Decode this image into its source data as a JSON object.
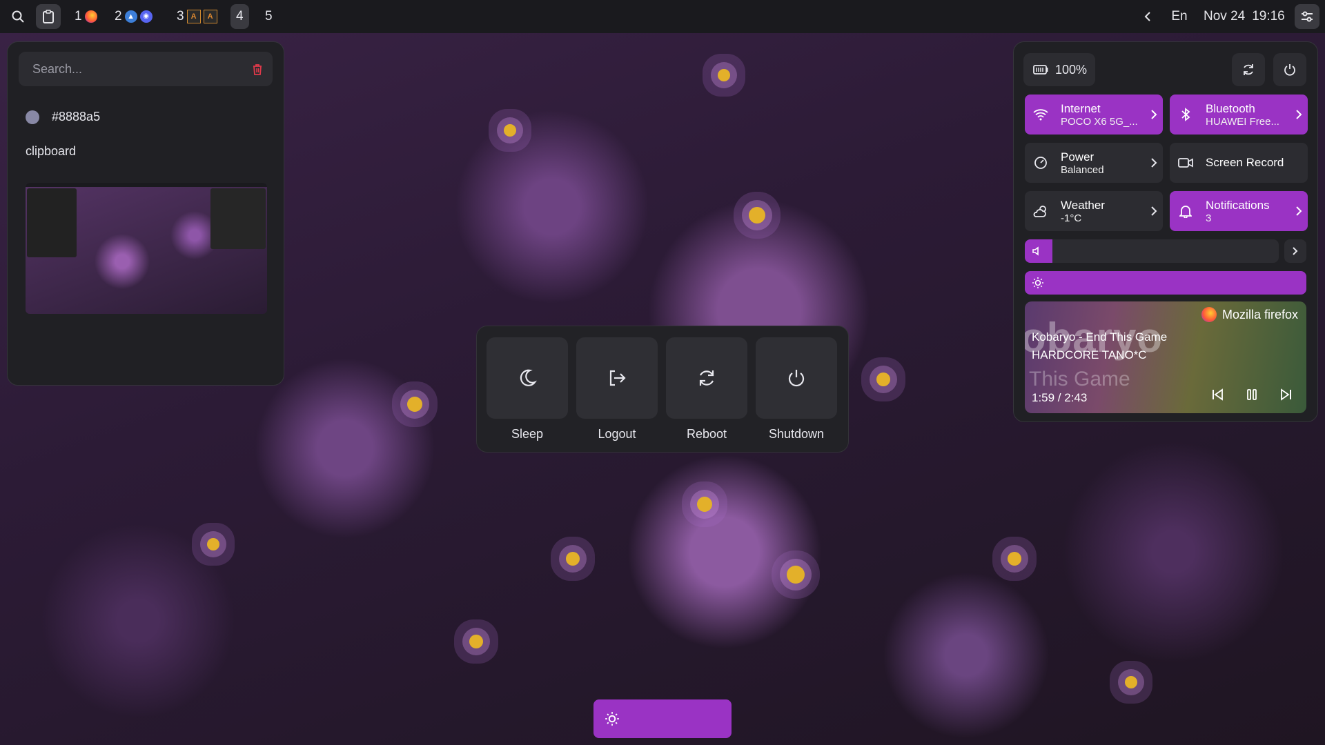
{
  "topbar": {
    "workspaces": [
      {
        "num": "1",
        "apps": [
          "firefox-icon"
        ]
      },
      {
        "num": "2",
        "apps": [
          "arch-icon",
          "discord-icon"
        ]
      },
      {
        "num": "3",
        "apps": [
          "app-a-icon",
          "app-a-icon"
        ]
      },
      {
        "num": "4",
        "apps": []
      },
      {
        "num": "5",
        "apps": []
      }
    ],
    "active_workspace": "4",
    "language": "En",
    "date": "Nov 24",
    "time": "19:16"
  },
  "clipboard": {
    "search_placeholder": "Search...",
    "items": [
      {
        "type": "color",
        "value": "#8888a5"
      },
      {
        "type": "text",
        "value": "clipboard"
      },
      {
        "type": "image",
        "value": "screenshot-thumbnail"
      }
    ]
  },
  "power_menu": {
    "items": [
      {
        "label": "Sleep",
        "icon": "moon-icon"
      },
      {
        "label": "Logout",
        "icon": "logout-icon"
      },
      {
        "label": "Reboot",
        "icon": "reboot-icon"
      },
      {
        "label": "Shutdown",
        "icon": "power-icon"
      }
    ]
  },
  "quick_settings": {
    "battery": "100%",
    "tiles": [
      {
        "title": "Internet",
        "subtitle": "POCO X6 5G_...",
        "icon": "wifi-icon",
        "active": true
      },
      {
        "title": "Bluetooth",
        "subtitle": "HUAWEI Free...",
        "icon": "bluetooth-icon",
        "active": true
      },
      {
        "title": "Power",
        "subtitle": "Balanced",
        "icon": "power-profile-icon",
        "active": false
      },
      {
        "title": "Screen Record",
        "subtitle": "",
        "icon": "camera-icon",
        "active": false
      },
      {
        "title": "Weather",
        "subtitle": "-1°C",
        "icon": "weather-icon",
        "active": false
      },
      {
        "title": "Notifications",
        "subtitle": "3",
        "icon": "bell-icon",
        "active": true
      }
    ],
    "volume_level": 0.1,
    "brightness_level": 1.0,
    "accent": "#9a33c4",
    "media": {
      "player": "Mozilla firefox",
      "title": "Kobaryo - End This Game",
      "artist": "HARDCORE TANO*C",
      "art_text_1": "obaryo",
      "art_text_2": "This Game",
      "position": "1:59 / 2:43"
    }
  },
  "osd": {
    "brightness_level": 1.0
  }
}
